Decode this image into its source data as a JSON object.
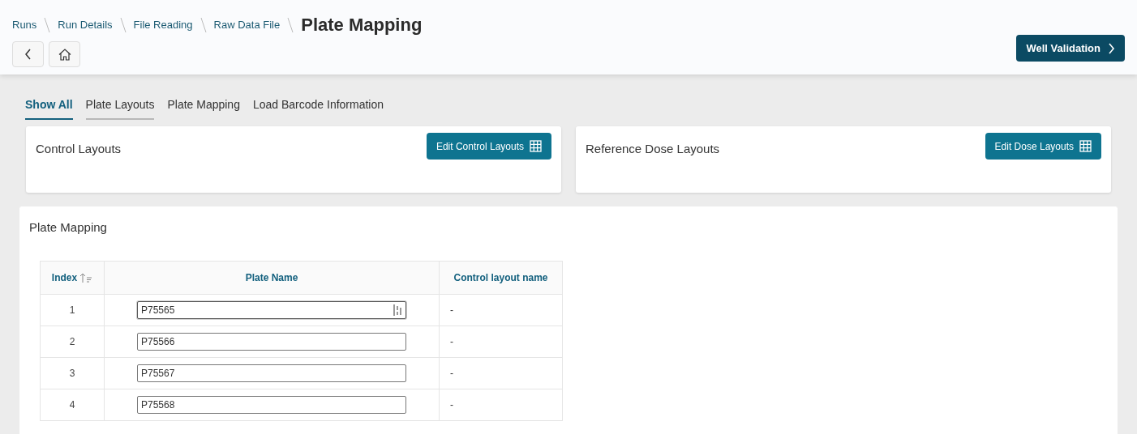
{
  "breadcrumbs": [
    "Runs",
    "Run Details",
    "File Reading",
    "Raw Data File"
  ],
  "title": "Plate Mapping",
  "next_button": "Well Validation",
  "tabs": [
    {
      "label": "Show All",
      "selected": true,
      "hovered": false
    },
    {
      "label": "Plate Layouts",
      "selected": false,
      "hovered": true
    },
    {
      "label": "Plate Mapping",
      "selected": false,
      "hovered": false
    },
    {
      "label": "Load Barcode Information",
      "selected": false,
      "hovered": false
    }
  ],
  "cards": [
    {
      "title": "Control Layouts",
      "button": "Edit Control Layouts"
    },
    {
      "title": "Reference Dose Layouts",
      "button": "Edit Dose Layouts"
    }
  ],
  "plate_mapping": {
    "title": "Plate Mapping",
    "columns": [
      "Index",
      "Plate Name",
      "Control layout name"
    ],
    "rows": [
      {
        "index": "1",
        "plate_name": "P75565",
        "control_layout": "-",
        "focused": true
      },
      {
        "index": "2",
        "plate_name": "P75566",
        "control_layout": "-",
        "focused": false
      },
      {
        "index": "3",
        "plate_name": "P75567",
        "control_layout": "-",
        "focused": false
      },
      {
        "index": "4",
        "plate_name": "P75568",
        "control_layout": "-",
        "focused": false
      }
    ]
  }
}
